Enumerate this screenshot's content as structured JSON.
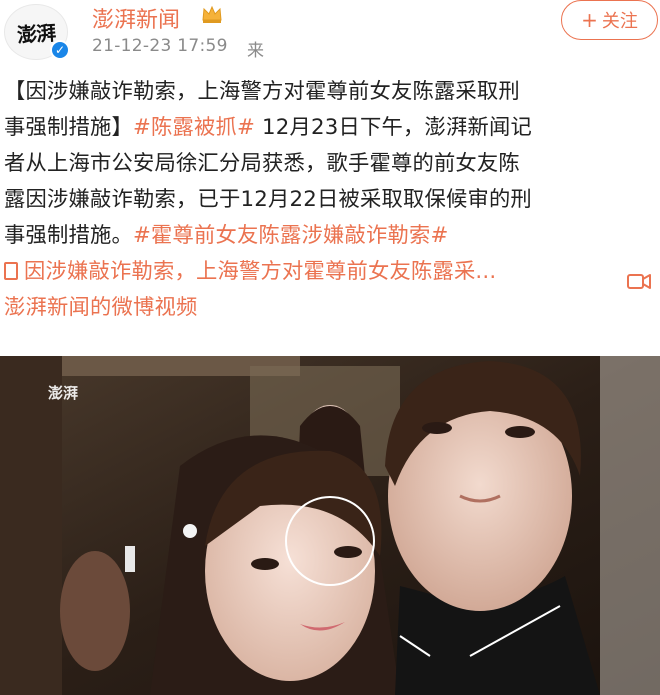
{
  "header": {
    "avatar_logo": "澎湃",
    "username": "澎湃新闻",
    "time": "21-12-23 17:59",
    "from": "来",
    "follow_label": "关注"
  },
  "post": {
    "line1": "【因涉嫌敲诈勒索，上海警方对霍尊前女友陈露采取刑",
    "line2_a": "事强制措施】",
    "line2_tag": "#陈露被抓#",
    "line2_b": " 12月23日下午，澎湃新闻记",
    "line3": "者从上海市公安局徐汇分局获悉，歌手霍尊的前女友陈",
    "line4": "露因涉嫌敲诈勒索，已于12月22日被采取取保候审的刑",
    "line5_a": "事强制措施。",
    "line5_tag": "#霍尊前女友陈露涉嫌敲诈勒索#",
    "link_text": "因涉嫌敲诈勒索，上海警方对霍尊前女友陈露采...",
    "video_source": "澎湃新闻的微博视频"
  },
  "video": {
    "watermark": "澎湃"
  },
  "colors": {
    "accent": "#eb7350",
    "verified": "#1a86e8"
  }
}
